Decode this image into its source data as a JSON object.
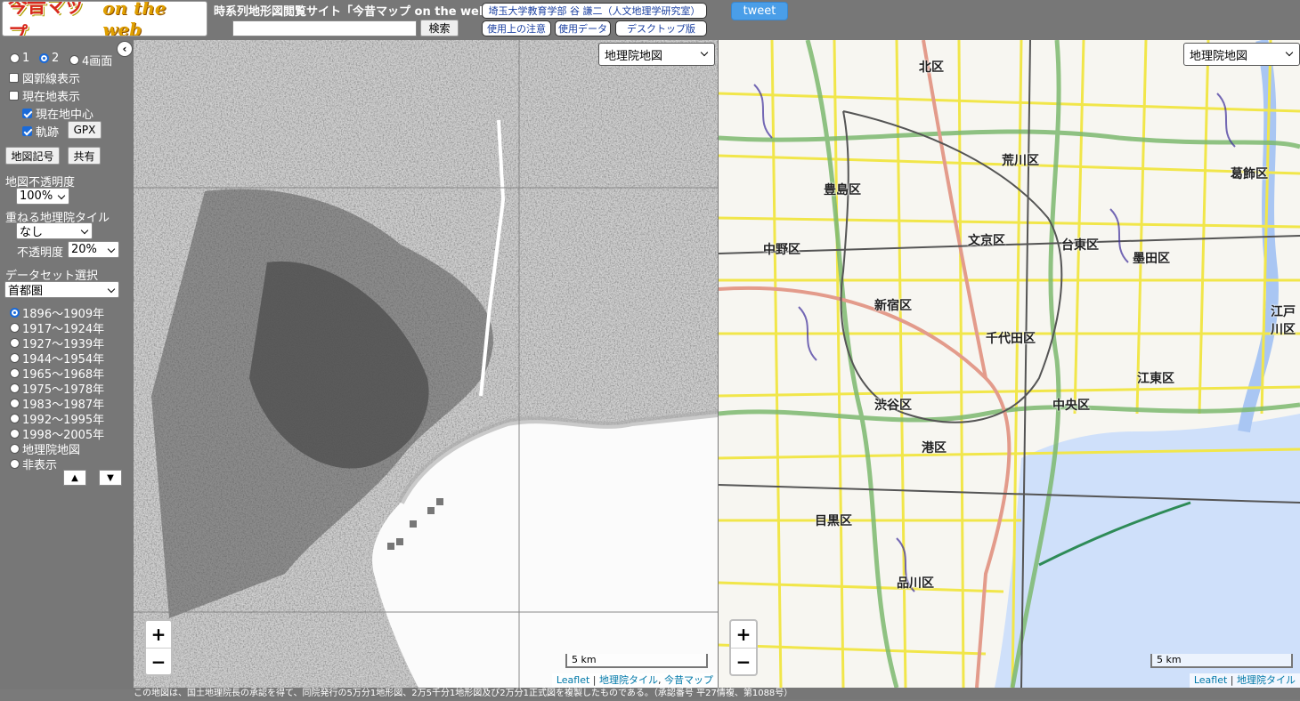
{
  "header": {
    "logo_text_main": "今昔マップ",
    "logo_text_sub": "on the web",
    "site_title": "時系列地形図閲覧サイト「今昔マップ on the web」",
    "search_value": "",
    "search_label": "検索",
    "links": {
      "lab": "埼玉大学教育学部 谷 謙二（人文地理学研究室）",
      "caution": "使用上の注意",
      "data": "使用データ",
      "desktop": "デスクトップ版"
    },
    "tweet_label": "tweet"
  },
  "sidebar": {
    "collapse_icon": "‹",
    "screen_modes": [
      "1",
      "2",
      "4画面"
    ],
    "screen_mode_selected": "2",
    "options": {
      "grid_label": "図郭線表示",
      "current_label": "現在地表示",
      "center_label": "現在地中心",
      "track_label": "軌跡",
      "gpx_label": "GPX"
    },
    "map_symbols_label": "地図記号",
    "share_label": "共有",
    "opacity_label": "地図不透明度",
    "opacity_value": "100%",
    "overlay_label": "重ねる地理院タイル",
    "overlay_value": "なし",
    "overlay_opacity_label": "不透明度",
    "overlay_opacity_value": "20%",
    "dataset_label": "データセット選択",
    "dataset_value": "首都圏",
    "periods": [
      "1896～1909年",
      "1917～1924年",
      "1927～1939年",
      "1944～1954年",
      "1965～1968年",
      "1975～1978年",
      "1983～1987年",
      "1992～1995年",
      "1998～2005年",
      "地理院地図",
      "非表示"
    ],
    "period_selected": "1896～1909年",
    "up_icon": "▲",
    "down_icon": "▼"
  },
  "map_left": {
    "select_value": "地理院地図",
    "zoom_in": "+",
    "zoom_out": "−",
    "scale_label": "5 km",
    "attribution": [
      "Leaflet",
      "地理院タイル",
      "今昔マップ"
    ]
  },
  "map_right": {
    "select_value": "地理院地図",
    "zoom_in": "+",
    "zoom_out": "−",
    "scale_label": "5 km",
    "attribution": [
      "Leaflet",
      "地理院タイル"
    ],
    "labels": [
      "北区",
      "荒川区",
      "豊島区",
      "文京区",
      "台東区",
      "墨田区",
      "葛飾区",
      "中野区",
      "新宿区",
      "千代田区",
      "江東区",
      "中央区",
      "渋谷区",
      "港区",
      "目黒区",
      "品川区",
      "江戸川区"
    ]
  },
  "footer_note": "この地図は、国土地理院長の承認を得て、同院発行の5万分1地形図、2万5千分1地形図及び2万分1正式図を複製したものである。（承認番号 平27情複、第1088号）"
}
